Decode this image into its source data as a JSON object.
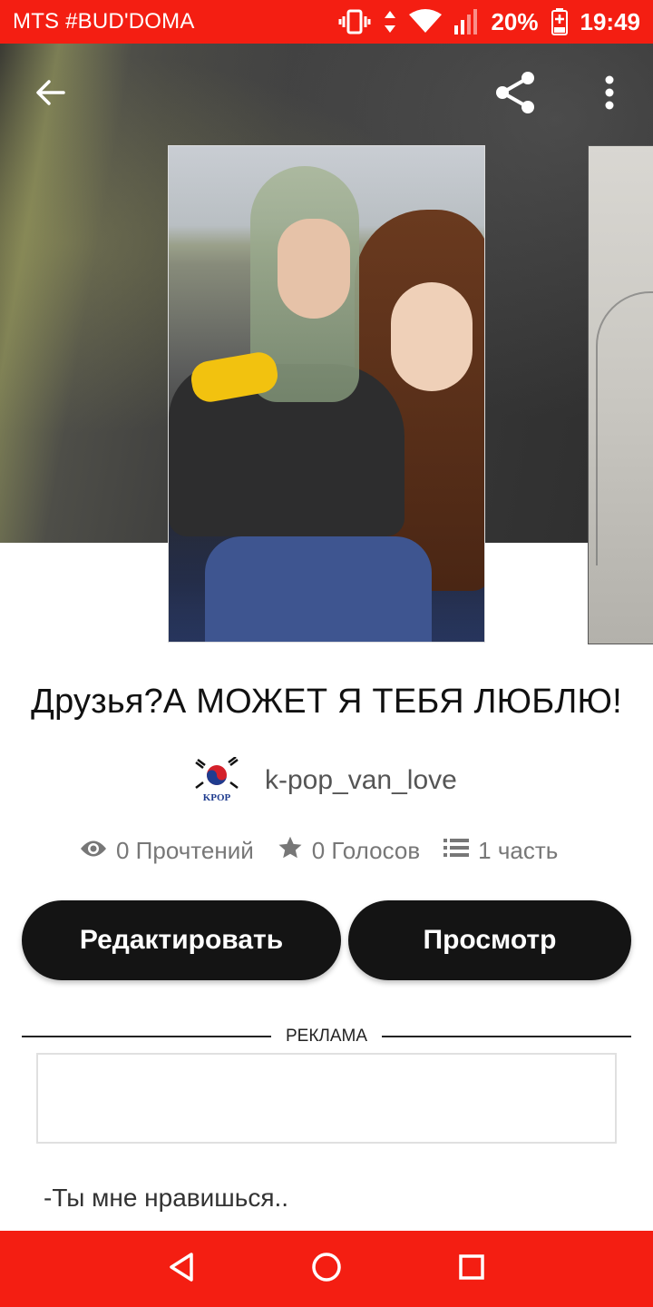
{
  "status_bar": {
    "carrier": "MTS #BUD'DOMA",
    "battery": "20%",
    "time": "19:49",
    "icons": [
      "vibrate-icon",
      "data-arrows-icon",
      "wifi-icon",
      "signal-icon",
      "battery-charging-icon"
    ]
  },
  "header": {
    "back_icon": "arrow-back-icon",
    "share_icon": "share-icon",
    "more_icon": "more-vertical-icon"
  },
  "story": {
    "title": "Друзья?А МОЖЕТ Я ТЕБЯ ЛЮБЛЮ!",
    "author": "k-pop_van_love",
    "avatar_text": "KPOP",
    "stats": {
      "reads": "0 Прочтений",
      "votes": "0 Голосов",
      "parts": "1 часть"
    }
  },
  "actions": {
    "edit_label": "Редактировать",
    "view_label": "Просмотр"
  },
  "ad": {
    "label": "РЕКЛАМА"
  },
  "preview": {
    "text": "-Ты мне нравишься.."
  },
  "nav": {
    "icons": [
      "back-triangle-icon",
      "home-circle-icon",
      "recents-square-icon"
    ]
  },
  "colors": {
    "status_bar": "#f41e12",
    "nav_bar": "#f41e12",
    "button_bg": "#141414"
  }
}
